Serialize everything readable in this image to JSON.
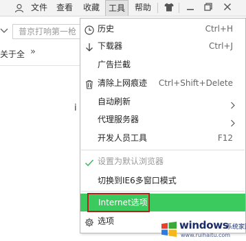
{
  "menubar": {
    "items": [
      {
        "label": "文件"
      },
      {
        "label": "查看"
      },
      {
        "label": "收藏"
      },
      {
        "label": "工具"
      },
      {
        "label": "帮助"
      }
    ],
    "user_icon": "user-icon",
    "skin_icon": "tshirt-icon",
    "window_buttons": [
      "minimize-icon",
      "restore-icon",
      "close-icon"
    ]
  },
  "address_bar": {
    "placeholder_text": "普京打响第一枪"
  },
  "bookmarks_bar": {
    "label": "关于全",
    "more": "»"
  },
  "background": {
    "partial_char": "i"
  },
  "tools_menu": {
    "items": [
      {
        "label": "历史",
        "shortcut": "Ctrl+H",
        "icon": "clock-icon"
      },
      {
        "label": "下载器",
        "shortcut": "Ctrl+J",
        "icon": "download-arrow-icon"
      },
      {
        "label": "广告拦截",
        "shortcut": ""
      },
      {
        "label": "清除上网痕迹",
        "shortcut": "Ctrl+Shift+Delete",
        "icon": "trash-icon"
      },
      {
        "label": "自动刷新",
        "shortcut": ""
      },
      {
        "label": "代理服务器",
        "shortcut": ""
      },
      {
        "label": "开发人员工具",
        "shortcut": "F12"
      },
      {
        "label": "设置为默认浏览器",
        "shortcut": "",
        "icon": "checkmark-icon",
        "disabled": true
      },
      {
        "label": "切换到IE6多窗口模式",
        "shortcut": ""
      },
      {
        "label": "Internet选项",
        "shortcut": "",
        "highlighted": true
      },
      {
        "label": "选项",
        "shortcut": "",
        "icon": "gear-icon"
      }
    ]
  },
  "watermark": {
    "title": "windows",
    "suffix": "系统家园",
    "url": "www.ruihaitu.com"
  },
  "colors": {
    "highlight": "#3bca5d",
    "red_box": "#b81f1f",
    "menubar_bg": "#f3f3f3"
  }
}
